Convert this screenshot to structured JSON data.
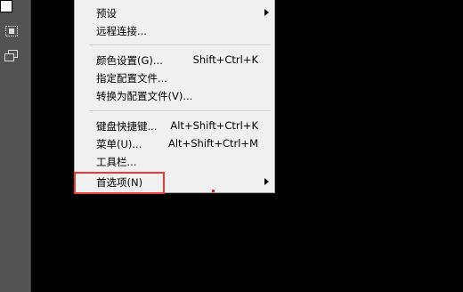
{
  "menu": {
    "items": [
      {
        "label": "预设",
        "shortcut": "",
        "submenu": true
      },
      {
        "label": "远程连接...",
        "shortcut": "",
        "submenu": false
      },
      {
        "label": "颜色设置(G)...",
        "shortcut": "Shift+Ctrl+K",
        "submenu": false
      },
      {
        "label": "指定配置文件...",
        "shortcut": "",
        "submenu": false
      },
      {
        "label": "转换为配置文件(V)...",
        "shortcut": "",
        "submenu": false
      },
      {
        "label": "键盘快捷键...",
        "shortcut": "Alt+Shift+Ctrl+K",
        "submenu": false
      },
      {
        "label": "菜单(U)...",
        "shortcut": "Alt+Shift+Ctrl+M",
        "submenu": false
      },
      {
        "label": "工具栏...",
        "shortcut": "",
        "submenu": false
      },
      {
        "label": "首选项(N)",
        "shortcut": "",
        "submenu": true
      }
    ]
  },
  "colors": {
    "highlight": "#e83a3a",
    "menu_bg": "#f0f0f0"
  }
}
